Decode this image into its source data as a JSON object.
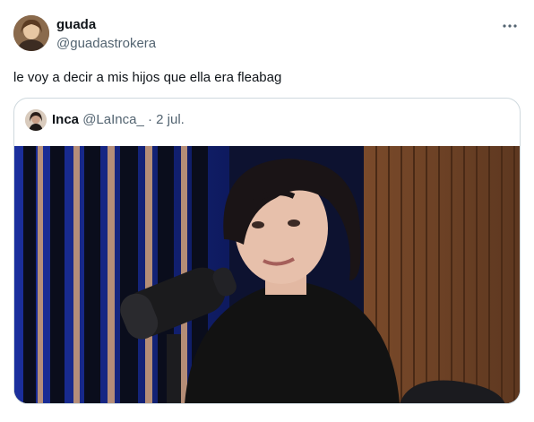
{
  "tweet": {
    "author": {
      "name": "guada",
      "handle": "@guadastrokera"
    },
    "text": "le voy a decir a mis hijos que ella era fleabag",
    "more_icon": "more-horizontal-icon"
  },
  "quoted_tweet": {
    "author": {
      "name": "Inca",
      "handle": "@LaInca_"
    },
    "separator": "·",
    "date": "2 jul.",
    "media_icon": "photo"
  },
  "colors": {
    "primary_text": "#0f1419",
    "secondary_text": "#536471",
    "border": "#cfd9de"
  }
}
